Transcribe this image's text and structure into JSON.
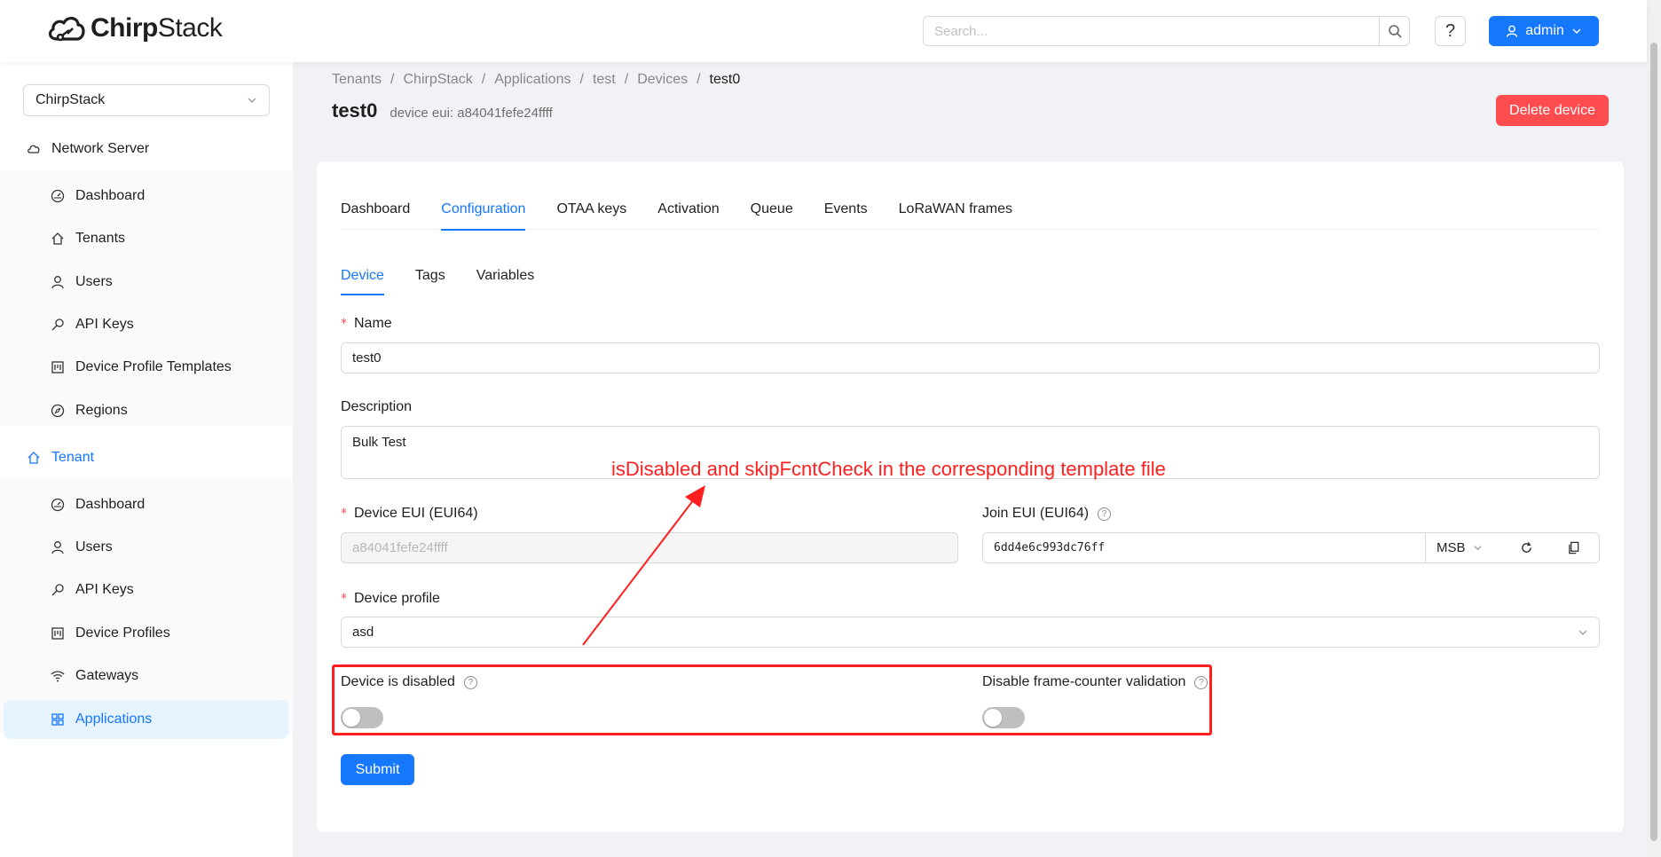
{
  "header": {
    "logo_text_bold": "Chirp",
    "logo_text_light": "Stack",
    "search_placeholder": "Search...",
    "help_label": "?",
    "user_label": "admin"
  },
  "sidebar": {
    "tenant_select": "ChirpStack",
    "groups": [
      {
        "label": "Network Server",
        "icon": "cloud-icon"
      },
      {
        "label": "Tenant",
        "icon": "home-icon"
      }
    ],
    "network_items": [
      {
        "label": "Dashboard",
        "icon": "dashboard-icon"
      },
      {
        "label": "Tenants",
        "icon": "home-icon"
      },
      {
        "label": "Users",
        "icon": "user-icon"
      },
      {
        "label": "API Keys",
        "icon": "key-icon"
      },
      {
        "label": "Device Profile Templates",
        "icon": "profile-icon"
      },
      {
        "label": "Regions",
        "icon": "compass-icon"
      }
    ],
    "tenant_items": [
      {
        "label": "Dashboard",
        "icon": "dashboard-icon"
      },
      {
        "label": "Users",
        "icon": "user-icon"
      },
      {
        "label": "API Keys",
        "icon": "key-icon"
      },
      {
        "label": "Device Profiles",
        "icon": "profile-icon"
      },
      {
        "label": "Gateways",
        "icon": "wifi-icon"
      },
      {
        "label": "Applications",
        "icon": "appstore-icon"
      }
    ]
  },
  "breadcrumb": [
    "Tenants",
    "ChirpStack",
    "Applications",
    "test",
    "Devices",
    "test0"
  ],
  "breadcrumb_sep": "/",
  "page": {
    "title": "test0",
    "subtitle": "device eui: a84041fefe24ffff",
    "delete_label": "Delete device"
  },
  "tabs": [
    "Dashboard",
    "Configuration",
    "OTAA keys",
    "Activation",
    "Queue",
    "Events",
    "LoRaWAN frames"
  ],
  "active_tab": "Configuration",
  "subtabs": [
    "Device",
    "Tags",
    "Variables"
  ],
  "active_subtab": "Device",
  "form": {
    "name_label": "Name",
    "name_value": "test0",
    "description_label": "Description",
    "description_value": "Bulk Test",
    "dev_eui_label": "Device EUI (EUI64)",
    "dev_eui_value": "a84041fefe24ffff",
    "join_eui_label": "Join EUI (EUI64)",
    "join_eui_value": "6dd4e6c993dc76ff",
    "byte_order": "MSB",
    "device_profile_label": "Device profile",
    "device_profile_value": "asd",
    "is_disabled_label": "Device is disabled",
    "is_disabled": false,
    "skip_fcnt_label": "Disable frame-counter validation",
    "skip_fcnt": false,
    "submit_label": "Submit"
  },
  "annotation": {
    "text": "isDisabled and skipFcntCheck in the corresponding template file",
    "color": "#ff1f1f"
  },
  "colors": {
    "primary": "#1677ff",
    "danger": "#ff4d4f"
  }
}
